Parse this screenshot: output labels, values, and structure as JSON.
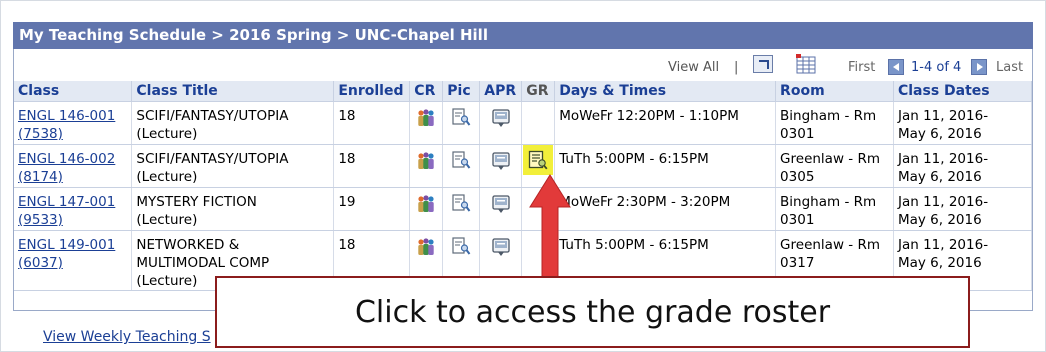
{
  "header": {
    "breadcrumb": "My Teaching Schedule > 2016 Spring > UNC-Chapel Hill"
  },
  "nav": {
    "view_all": "View All",
    "separator": "|",
    "first": "First",
    "range": "1-4 of 4",
    "last": "Last"
  },
  "columns": {
    "class": "Class",
    "title": "Class Title",
    "enrolled": "Enrolled",
    "cr": "CR",
    "pic": "Pic",
    "apr": "APR",
    "gr": "GR",
    "days": "Days & Times",
    "room": "Room",
    "dates": "Class Dates"
  },
  "rows": [
    {
      "class_code": "ENGL 146-001",
      "class_num": "(7538)",
      "title": "SCIFI/FANTASY/UTOPIA",
      "title2": "(Lecture)",
      "enrolled": "18",
      "days": "MoWeFr 12:20PM - 1:10PM",
      "room1": "Bingham - Rm",
      "room2": "0301",
      "dates1": "Jan 11, 2016-",
      "dates2": "May 6, 2016"
    },
    {
      "class_code": "ENGL 146-002",
      "class_num": "(8174)",
      "title": "SCIFI/FANTASY/UTOPIA",
      "title2": "(Lecture)",
      "enrolled": "18",
      "days": "TuTh 5:00PM - 6:15PM",
      "room1": "Greenlaw - Rm",
      "room2": "0305",
      "dates1": "Jan 11, 2016-",
      "dates2": "May 6, 2016"
    },
    {
      "class_code": "ENGL 147-001",
      "class_num": "(9533)",
      "title": "MYSTERY FICTION",
      "title2": "(Lecture)",
      "enrolled": "19",
      "days": "MoWeFr 2:30PM - 3:20PM",
      "room1": "Bingham - Rm",
      "room2": "0301",
      "dates1": "Jan 11, 2016-",
      "dates2": "May 6, 2016"
    },
    {
      "class_code": "ENGL 149-001",
      "class_num": "(6037)",
      "title": "NETWORKED &",
      "title2": "MULTIMODAL COMP",
      "title3": "(Lecture)",
      "enrolled": "18",
      "days": "TuTh 5:00PM - 6:15PM",
      "room1": "Greenlaw - Rm",
      "room2": "0317",
      "dates1": "Jan 11, 2016-",
      "dates2": "May 6, 2016"
    }
  ],
  "callout": {
    "text": "Click to access the grade roster"
  },
  "footer": {
    "link": "View Weekly Teaching S"
  },
  "colors": {
    "title_bar": "#6175ad",
    "link": "#1b3f95",
    "highlight": "#f2ef3a",
    "arrow": "#e23a3a",
    "callout_border": "#8b1c1c"
  },
  "icons": {
    "cr": "class-roster-people-icon",
    "pic": "photo-roster-icon",
    "apr": "attendance-report-icon",
    "gr": "grade-roster-icon"
  }
}
